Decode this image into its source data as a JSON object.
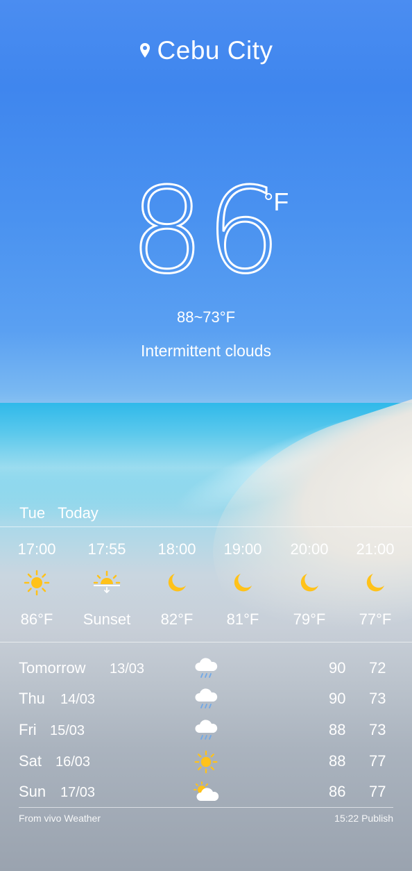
{
  "location": {
    "city": "Cebu City",
    "icon": "location-pin-icon"
  },
  "current": {
    "temperature": "86",
    "unit": "°F",
    "range": "88~73°F",
    "condition": "Intermittent clouds"
  },
  "today_header": {
    "weekday": "Tue",
    "label": "Today"
  },
  "hourly": [
    {
      "time": "17:00",
      "icon": "sun-icon",
      "value": "86°F"
    },
    {
      "time": "17:55",
      "icon": "sunset-icon",
      "value": "Sunset"
    },
    {
      "time": "18:00",
      "icon": "moon-icon",
      "value": "82°F"
    },
    {
      "time": "19:00",
      "icon": "moon-icon",
      "value": "81°F"
    },
    {
      "time": "20:00",
      "icon": "moon-icon",
      "value": "79°F"
    },
    {
      "time": "21:00",
      "icon": "moon-icon",
      "value": "77°F"
    }
  ],
  "daily": [
    {
      "day": "Tomorrow",
      "date": "13/03",
      "icon": "rain-cloud-icon",
      "high": "90",
      "low": "72"
    },
    {
      "day": "Thu",
      "date": "14/03",
      "icon": "rain-cloud-icon",
      "high": "90",
      "low": "73"
    },
    {
      "day": "Fri",
      "date": "15/03",
      "icon": "rain-cloud-icon",
      "high": "88",
      "low": "73"
    },
    {
      "day": "Sat",
      "date": "16/03",
      "icon": "sun-icon",
      "high": "88",
      "low": "77"
    },
    {
      "day": "Sun",
      "date": "17/03",
      "icon": "partly-cloudy-icon",
      "high": "86",
      "low": "77"
    }
  ],
  "footer": {
    "source": "From vivo Weather",
    "publish": "15:22 Publish"
  },
  "colors": {
    "sky": "#4b8df1",
    "sun": "#ffc21a",
    "text": "#ffffff"
  }
}
